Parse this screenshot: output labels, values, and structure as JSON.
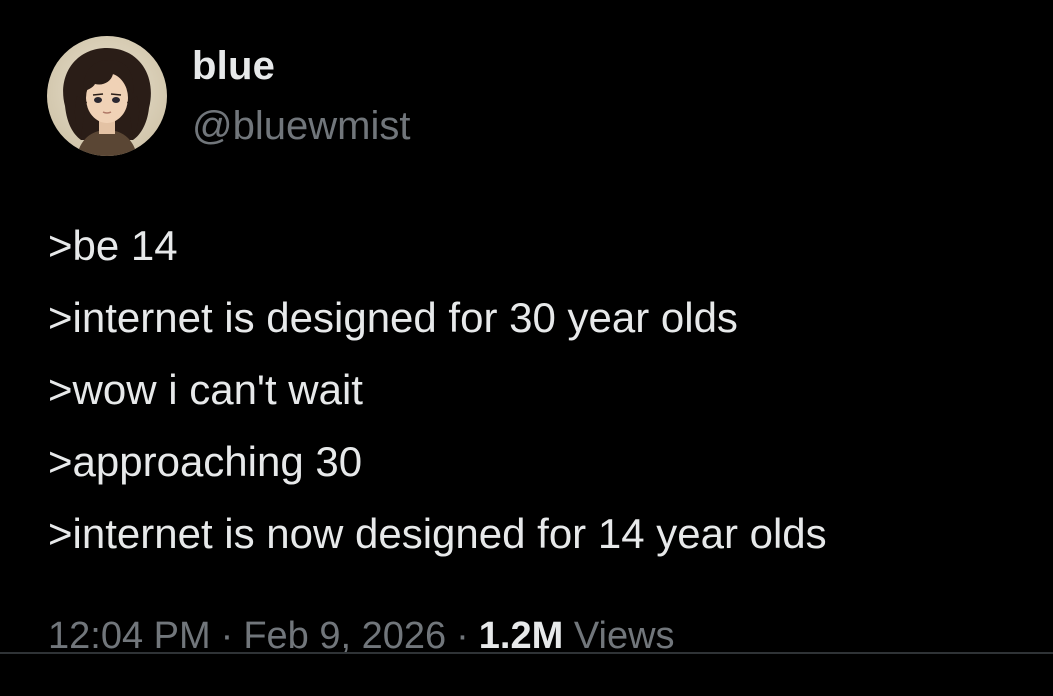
{
  "author": {
    "display_name": "blue",
    "handle": "@bluewmist",
    "avatar_icon": "anime-avatar-icon"
  },
  "tweet": {
    "lines": [
      ">be 14",
      ">internet is designed for 30 year olds",
      ">wow i can't wait",
      ">approaching 30",
      ">internet is now designed for 14 year olds"
    ]
  },
  "meta": {
    "time": "12:04 PM",
    "separator": "·",
    "date": "Feb 9, 2026",
    "views_count": "1.2M",
    "views_label": "Views"
  },
  "colors": {
    "background": "#000000",
    "primary_text": "#e7e9ea",
    "secondary_text": "#71767b",
    "divider": "#2f3336"
  }
}
